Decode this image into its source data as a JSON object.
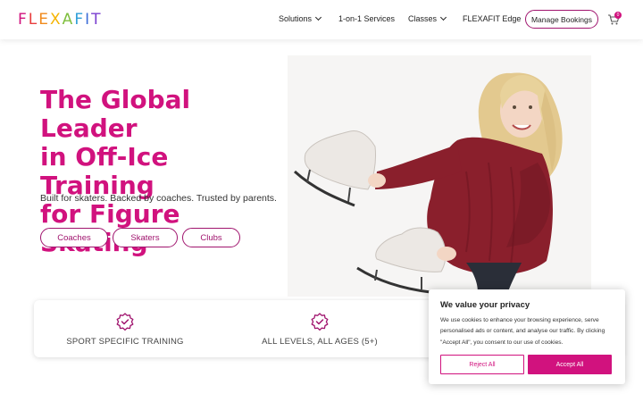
{
  "header": {
    "logo_letters": [
      "F",
      "L",
      "E",
      "X",
      "A",
      "F",
      "I",
      "T"
    ],
    "logo_colors": [
      "#d1127e",
      "#e83e3e",
      "#f08a1c",
      "#f5b400",
      "#7fbf3f",
      "#2e9fd8",
      "#3f6fd8",
      "#7a3fd0"
    ],
    "nav": {
      "solutions": "Solutions",
      "services": "1-on-1 Services",
      "classes": "Classes",
      "edge": "FLEXAFIT Edge"
    },
    "manage_bookings": "Manage Bookings",
    "cart_count": "0"
  },
  "hero": {
    "title_line1": "The Global Leader",
    "title_line2": "in Off-Ice Training",
    "title_line3": "for Figure Skating",
    "subtitle": "Built for skaters. Backed by coaches. Trusted by parents.",
    "buttons": [
      "Coaches",
      "Skaters",
      "Clubs"
    ]
  },
  "features": [
    {
      "label": "SPORT SPECIFIC TRAINING",
      "icon": "verified-badge-icon"
    },
    {
      "label": "ALL LEVELS, ALL AGES (5+)",
      "icon": "verified-badge-icon"
    }
  ],
  "cookie": {
    "title": "We value your privacy",
    "text": "We use cookies to enhance your browsing experience, serve personalised ads or content, and analyse our traffic. By clicking \"Accept All\", you consent to our use of cookies.",
    "reject": "Reject All",
    "accept": "Accept All"
  },
  "colors": {
    "brand": "#d1127e",
    "brand_dark": "#a0146e",
    "sweater": "#8a1f2c"
  }
}
